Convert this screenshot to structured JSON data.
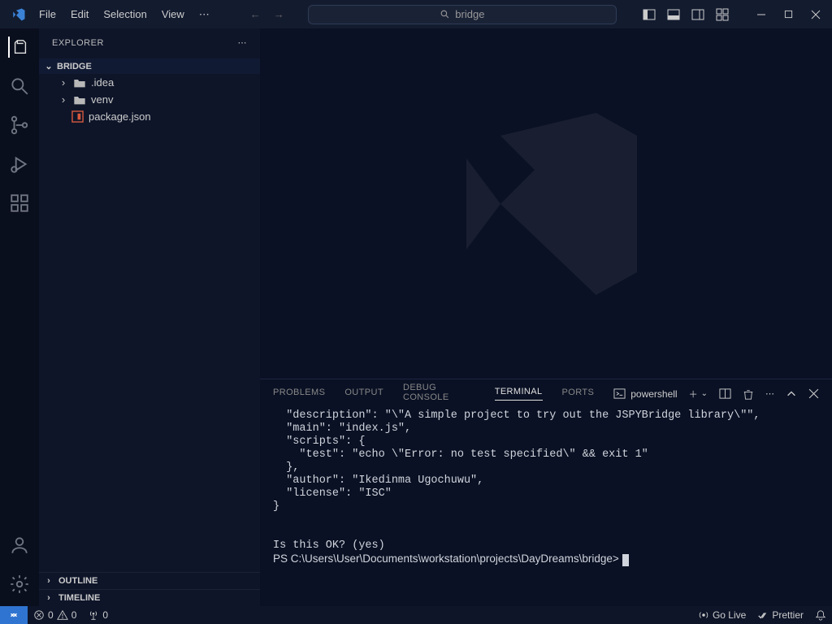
{
  "menu": {
    "file": "File",
    "edit": "Edit",
    "selection": "Selection",
    "view": "View"
  },
  "search": {
    "placeholder": "bridge"
  },
  "explorer": {
    "title": "EXPLORER"
  },
  "tree": {
    "root": "BRIDGE",
    "items": [
      {
        "label": ".idea",
        "type": "folder"
      },
      {
        "label": "venv",
        "type": "folder"
      },
      {
        "label": "package.json",
        "type": "file"
      }
    ]
  },
  "collapse": {
    "outline": "OUTLINE",
    "timeline": "TIMELINE"
  },
  "panel": {
    "problems": "PROBLEMS",
    "output": "OUTPUT",
    "debug": "DEBUG CONSOLE",
    "terminal": "TERMINAL",
    "ports": "PORTS",
    "shell": "powershell"
  },
  "terminal_lines": [
    "  \"description\": \"\\\"A simple project to try out the JSPYBridge library\\\"\",",
    "  \"main\": \"index.js\",",
    "  \"scripts\": {",
    "    \"test\": \"echo \\\"Error: no test specified\\\" && exit 1\"",
    "  },",
    "  \"author\": \"Ikedinma Ugochuwu\",",
    "  \"license\": \"ISC\"",
    "}",
    "",
    "",
    "Is this OK? (yes)"
  ],
  "terminal_prompt": "PS C:\\Users\\User\\Documents\\workstation\\projects\\DayDreams\\bridge> ",
  "status": {
    "errors": "0",
    "warnings": "0",
    "ports": "0",
    "golive": "Go Live",
    "prettier": "Prettier"
  }
}
